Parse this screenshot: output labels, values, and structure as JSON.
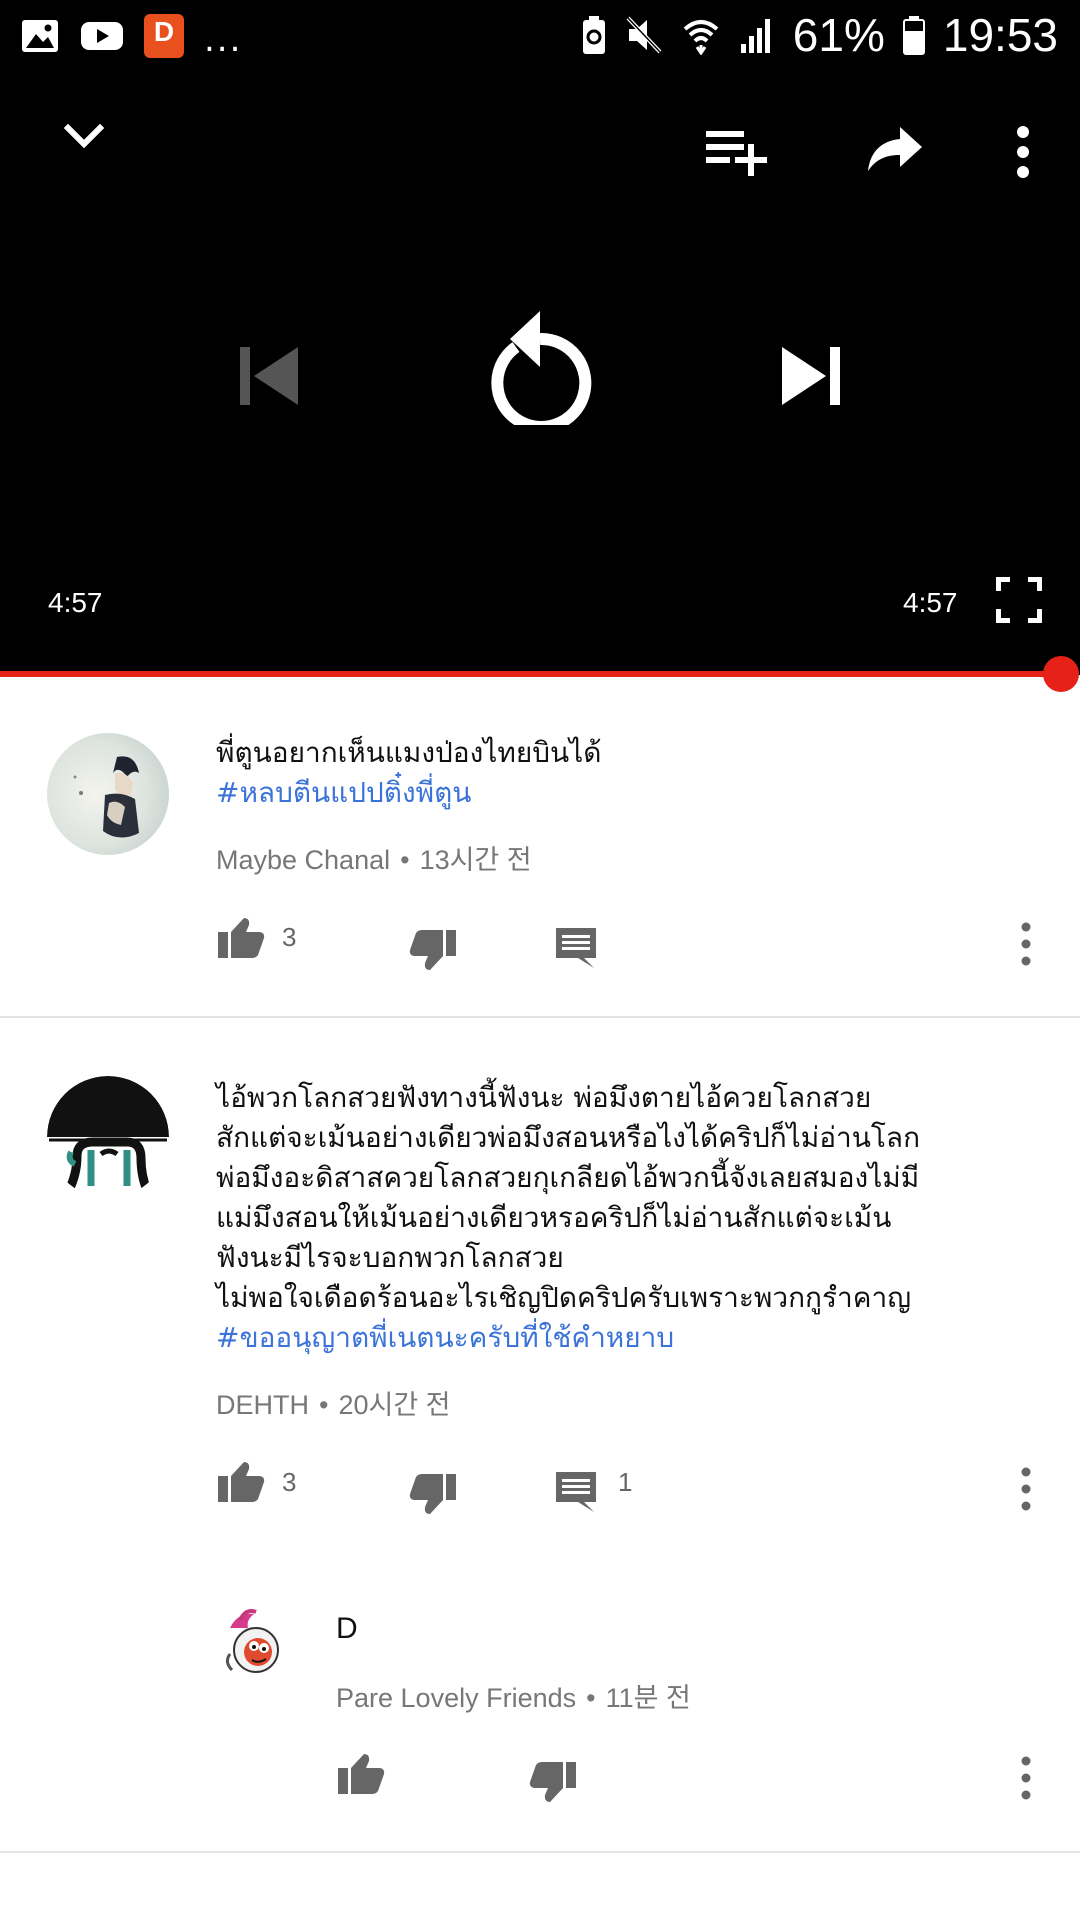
{
  "status_bar": {
    "battery": "61%",
    "time": "19:53",
    "more_notifications": "...",
    "icons": [
      "image-icon",
      "youtube-icon",
      "app-d-icon",
      "battery-saver-icon",
      "mute-icon",
      "wifi-icon",
      "signal-icon",
      "battery-icon"
    ],
    "app_letter": "D"
  },
  "player": {
    "elapsed": "4:57",
    "duration": "4:57",
    "progress_fraction": 1.0,
    "icons": [
      "collapse-icon",
      "add-to-queue-icon",
      "share-icon",
      "more-options-icon",
      "previous-icon",
      "replay-icon",
      "next-icon",
      "fullscreen-icon"
    ],
    "accent_color": "#e62117"
  },
  "comments": [
    {
      "lines": [
        "พี่ตูนอยากเห็นแมงป่องไทยบินได้"
      ],
      "hashtag": "#หลบตีนแปปติ๋งพี่ตูน",
      "author": "Maybe Chanal",
      "time": "13시간 전",
      "likes": "3",
      "replies": ""
    },
    {
      "lines": [
        "ไอ้พวกโลกสวยฟังทางนี้ฟังนะ พ่อมึงตายไอ้ควยโลกสวย",
        "สักแต่จะเม้นอย่างเดียวพ่อมึงสอนหรือไงได้คริปก็ไม่อ่านโลก",
        "พ่อมึงอะดิสาสควยโลกสวยกุเกลียดไอ้พวกนี้จังเลยสมองไม่มี",
        "แม่มึงสอนให้เม้นอย่างเดียวหรอคริปก็ไม่อ่านสักแต่จะเม้น",
        "ฟังนะมีไรจะบอกพวกโลกสวย",
        "ไม่พอใจเดือดร้อนอะไรเชิญปิดคริปครับเพราะพวกกูรำคาญ"
      ],
      "hashtag": "#ขออนุญาตพี่เนตนะครับที่ใช้คำหยาบ",
      "author": "DEHTH",
      "time": "20시간 전",
      "likes": "3",
      "replies": "1"
    }
  ],
  "reply": {
    "text": "D",
    "author": "Pare Lovely Friends",
    "time": "11분 전"
  },
  "separator": "•"
}
